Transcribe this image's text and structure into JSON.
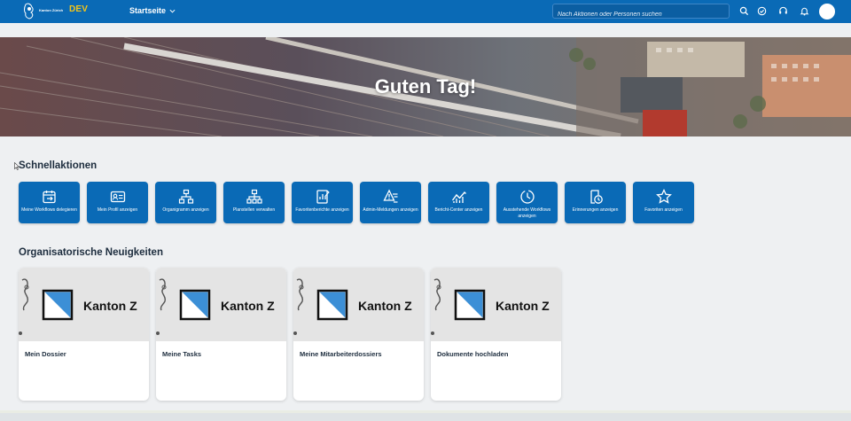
{
  "header": {
    "brand_small": "Kanton Zürich",
    "brand_env": "DEV",
    "nav_title": "Startseite",
    "search_placeholder": "Nach Aktionen oder Personen suchen",
    "icons": [
      "search-icon",
      "check-circle-icon",
      "headset-icon",
      "bell-icon",
      "avatar"
    ]
  },
  "banner": {
    "greeting": "Guten Tag!"
  },
  "quick_actions": {
    "title": "Schnellaktionen",
    "items": [
      {
        "label": "Meine Workflows delegieren",
        "icon": "calendar-delegate-icon"
      },
      {
        "label": "Mein Profil anzeigen",
        "icon": "id-card-icon"
      },
      {
        "label": "Organigramm anzeigen",
        "icon": "org-chart-icon"
      },
      {
        "label": "Planstellen verwalten",
        "icon": "hierarchy-icon"
      },
      {
        "label": "Favoritenberichte anzeigen",
        "icon": "report-icon"
      },
      {
        "label": "Admin-Meldungen anzeigen",
        "icon": "alert-list-icon"
      },
      {
        "label": "Bericht-Center anzeigen",
        "icon": "line-chart-icon"
      },
      {
        "label": "Ausstehende Workflows anzeigen",
        "icon": "pending-clock-icon"
      },
      {
        "label": "Erinnerungen anzeigen",
        "icon": "reminder-icon"
      },
      {
        "label": "Favoriten anzeigen",
        "icon": "star-icon"
      }
    ]
  },
  "news": {
    "title": "Organisatorische Neuigkeiten",
    "image_text": "Kanton Z",
    "cards": [
      {
        "label": "Mein Dossier"
      },
      {
        "label": "Meine Tasks"
      },
      {
        "label": "Meine Mitarbeiterdossiers"
      },
      {
        "label": "Dokumente hochladen"
      }
    ]
  },
  "colors": {
    "shellbar": "#0a6ab6",
    "accent_dev": "#f5c518",
    "tile": "#0a6ab6",
    "background": "#eef0f2"
  }
}
